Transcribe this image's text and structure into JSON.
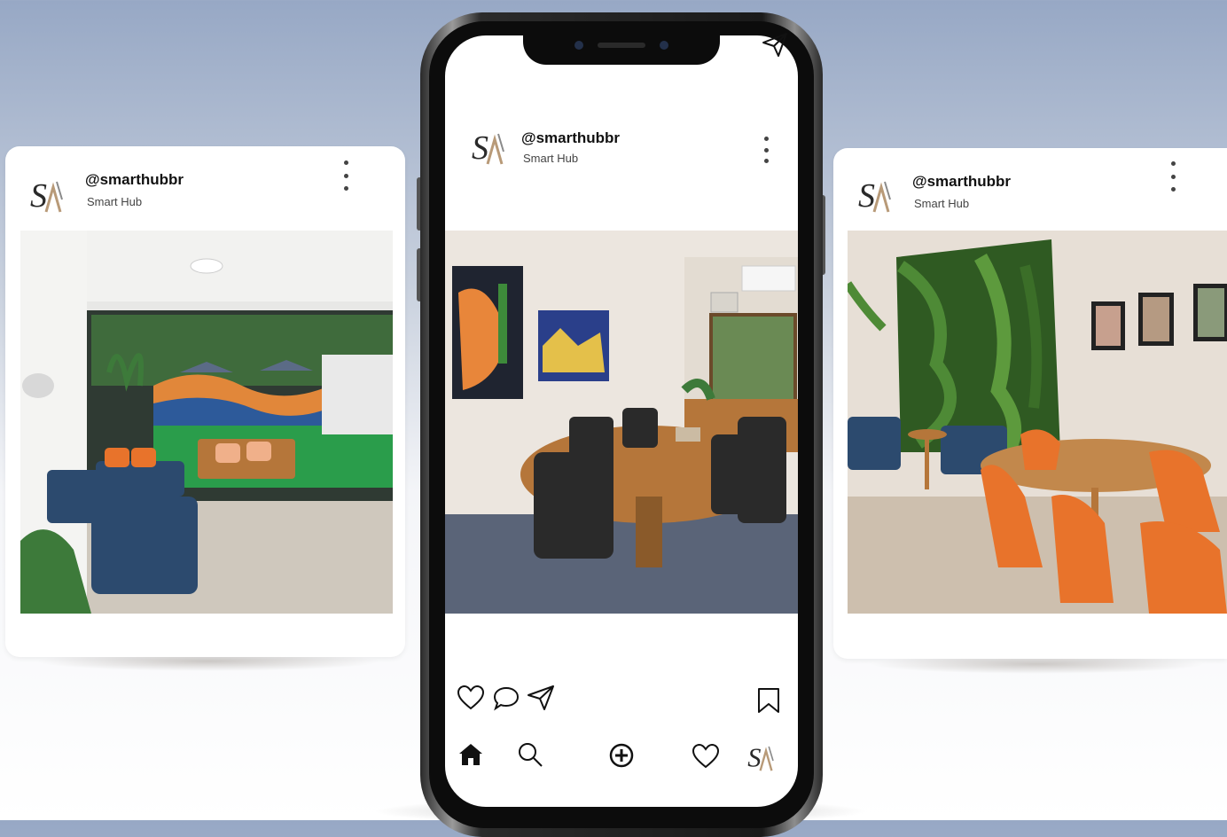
{
  "profile": {
    "handle": "@smarthubbr",
    "name": "Smart Hub"
  },
  "posts": [
    {
      "image": "outdoor-lounge-photo"
    },
    {
      "image": "meeting-room-photo"
    },
    {
      "image": "green-wall-cafe-photo"
    }
  ],
  "actions": [
    "heart-icon",
    "comment-icon",
    "share-icon",
    "bookmark-icon"
  ],
  "bottom_nav": [
    "home-icon",
    "search-icon",
    "add-icon",
    "activity-heart-icon",
    "profile-avatar"
  ],
  "colors": {
    "background_top": "#97a8c5",
    "orange_chairs": "#e8732b",
    "blue_chairs": "#2c4a6e",
    "wood_table": "#b5763a",
    "grass": "#2a9d4b"
  }
}
